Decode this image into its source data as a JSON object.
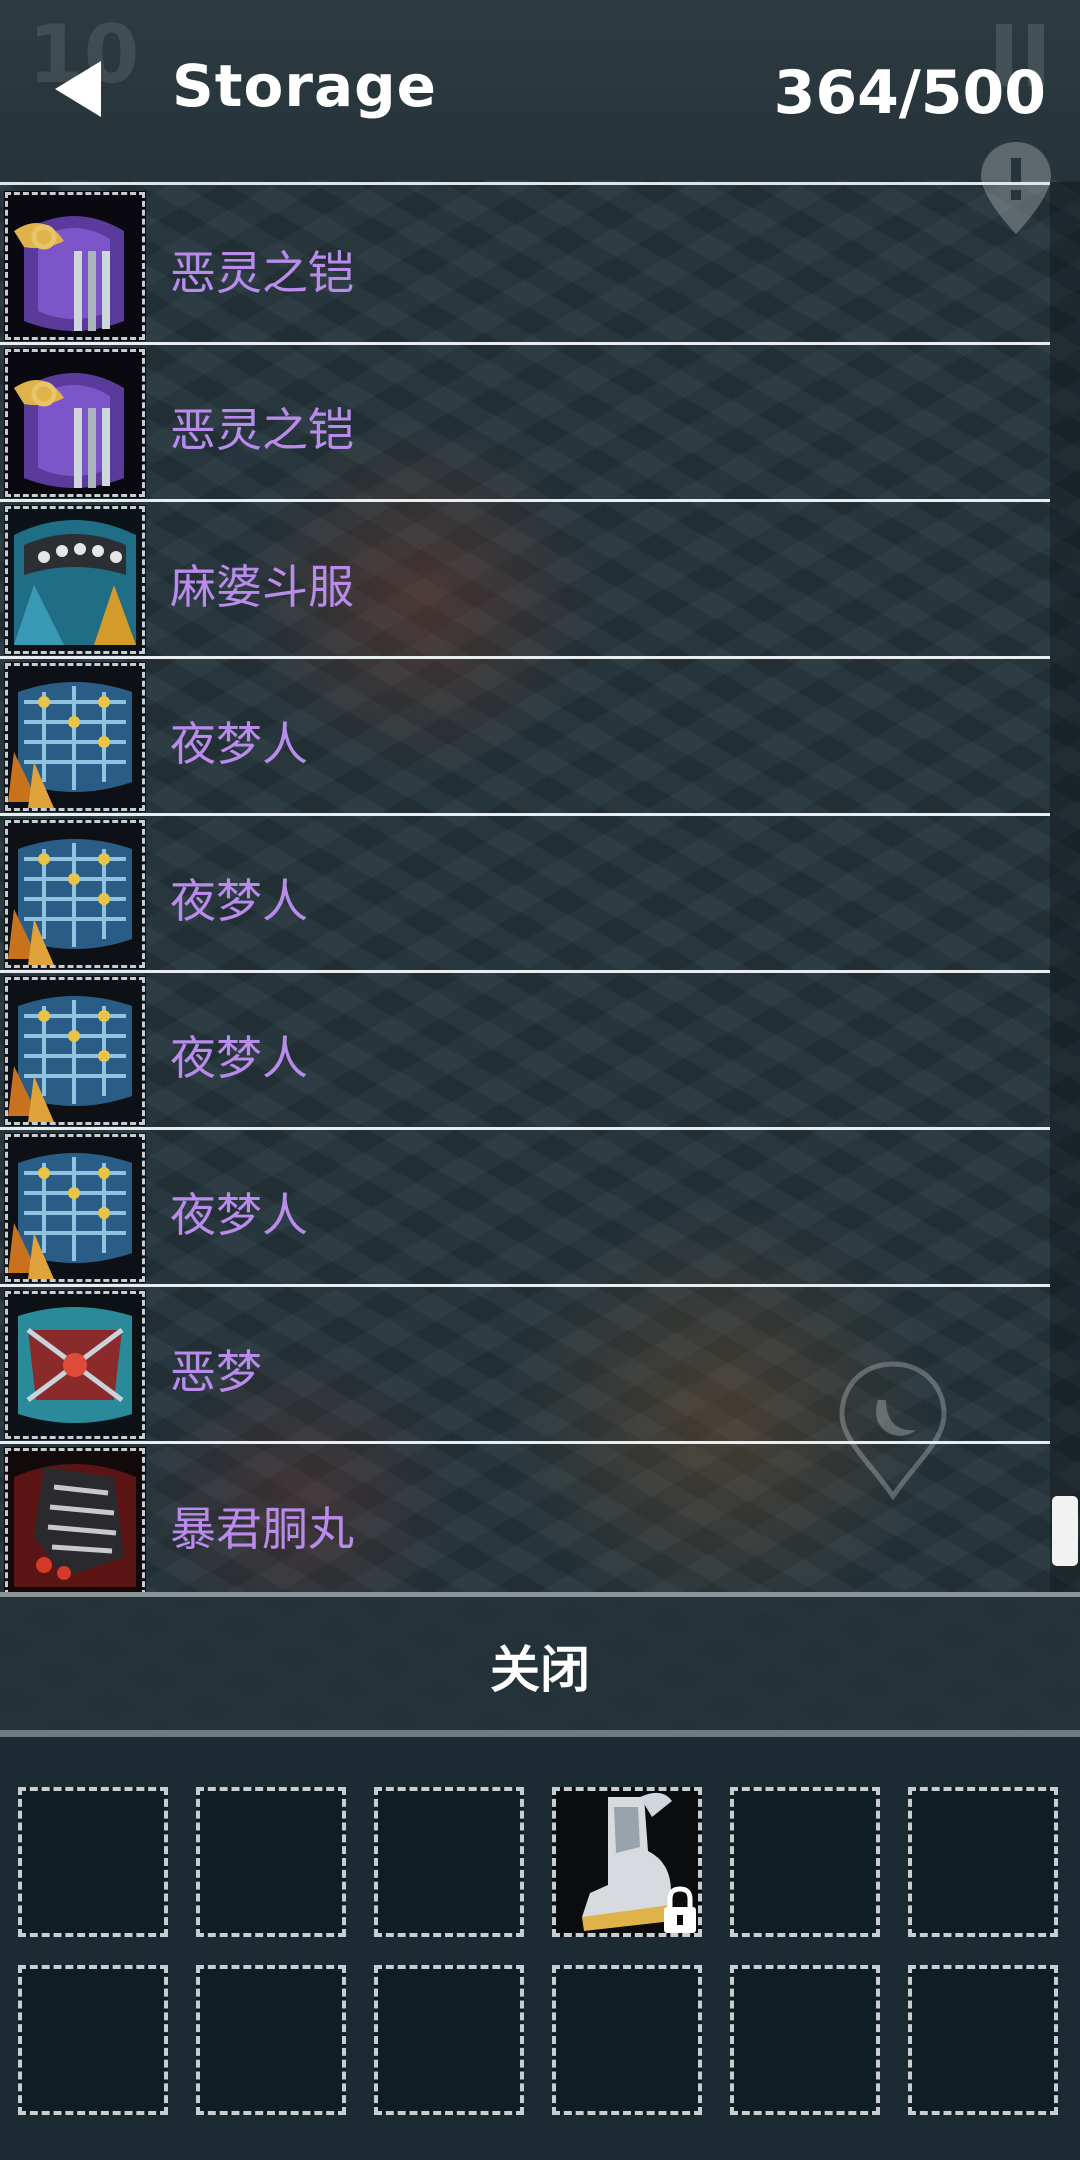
{
  "header": {
    "title": "Storage",
    "capacity": "364/500",
    "level_hint": "10"
  },
  "storage_items": [
    {
      "name": "恶灵之铠",
      "icon": "purple-armor-icon"
    },
    {
      "name": "恶灵之铠",
      "icon": "purple-armor-icon"
    },
    {
      "name": "麻婆斗服",
      "icon": "teal-robe-icon"
    },
    {
      "name": "夜梦人",
      "icon": "blue-gold-armor-icon"
    },
    {
      "name": "夜梦人",
      "icon": "blue-gold-armor-icon"
    },
    {
      "name": "夜梦人",
      "icon": "blue-gold-armor-icon"
    },
    {
      "name": "夜梦人",
      "icon": "blue-gold-armor-icon"
    },
    {
      "name": "恶梦",
      "icon": "red-teal-armor-icon"
    },
    {
      "name": "暴君胴丸",
      "icon": "dark-red-armor-icon"
    }
  ],
  "close_label": "关闭",
  "bag": {
    "rows": 2,
    "columns": 6,
    "slots": [
      {
        "item": null
      },
      {
        "item": null
      },
      {
        "item": null
      },
      {
        "item": "boots-icon",
        "locked": true
      },
      {
        "item": null
      },
      {
        "item": null
      },
      {
        "item": null
      },
      {
        "item": null
      },
      {
        "item": null
      },
      {
        "item": null
      },
      {
        "item": null
      },
      {
        "item": null
      }
    ]
  },
  "colors": {
    "item_name": "#b98bea",
    "background": "#1d2a31",
    "header_text": "#ffffff"
  }
}
